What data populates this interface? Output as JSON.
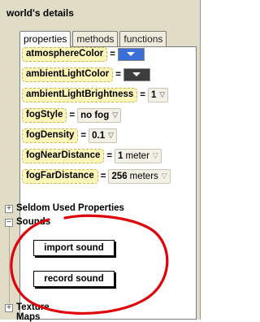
{
  "window": {
    "title": "world's details"
  },
  "tabs": [
    {
      "label": "properties",
      "active": true
    },
    {
      "label": "methods",
      "active": false
    },
    {
      "label": "functions",
      "active": false
    }
  ],
  "properties": [
    {
      "name": "atmosphereColor",
      "eq": "=",
      "kind": "color",
      "swatch": "#3a6fd8"
    },
    {
      "name": "ambientLightColor",
      "eq": "=",
      "kind": "color",
      "swatch": "#3c3c3c"
    },
    {
      "name": "ambientLightBrightness",
      "eq": "=",
      "kind": "value",
      "value": "1"
    },
    {
      "name": "fogStyle",
      "eq": "=",
      "kind": "value",
      "value": "no fog"
    },
    {
      "name": "fogDensity",
      "eq": "=",
      "kind": "value",
      "value": "0.1"
    },
    {
      "name": "fogNearDistance",
      "eq": "=",
      "kind": "value",
      "value_bold": "1",
      "value_unit": "meter"
    },
    {
      "name": "fogFarDistance",
      "eq": "=",
      "kind": "value",
      "value_bold": "256",
      "value_unit": "meters"
    }
  ],
  "seldom": {
    "expander": "+",
    "label": "Seldom Used Properties"
  },
  "sounds": {
    "expander": "−",
    "label": "Sounds",
    "import_label": "import sound",
    "record_label": "record sound"
  },
  "texture": {
    "expander": "+",
    "label": "Texture Maps"
  },
  "colors": {
    "panel_bg": "#e1dcc6",
    "tile_bg": "#fdf6b8",
    "annotation": "#e0000a"
  },
  "icons": {
    "dropdown": "chevron-down-icon",
    "expand": "plus-box-icon",
    "collapse": "minus-box-icon"
  }
}
